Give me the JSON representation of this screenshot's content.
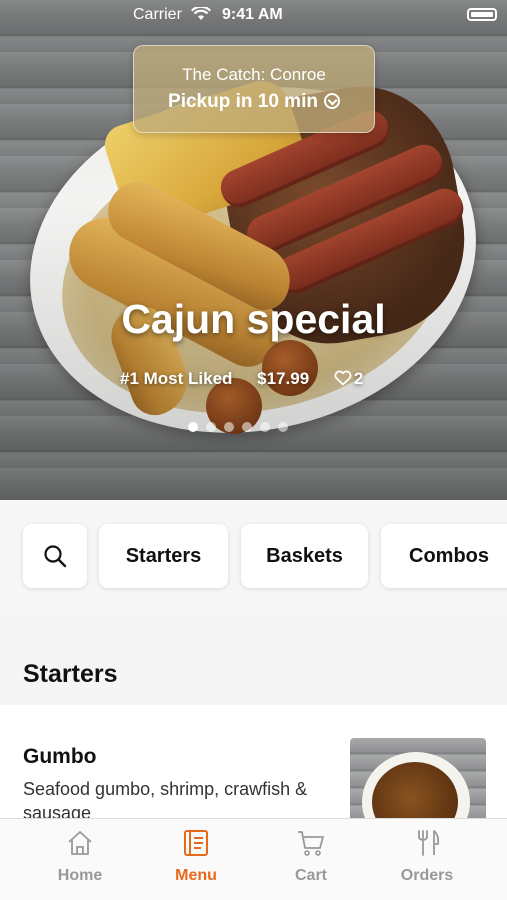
{
  "status_bar": {
    "carrier": "Carrier",
    "time": "9:41 AM"
  },
  "pickup": {
    "location": "The Catch: Conroe",
    "eta": "Pickup in 10 min"
  },
  "hero": {
    "title": "Cajun special",
    "badge": "#1 Most Liked",
    "price": "$17.99",
    "likes": "2",
    "slide_count": 6,
    "active_slide": 1
  },
  "categories": {
    "search_icon": "search-icon",
    "items": [
      "Starters",
      "Baskets",
      "Combos"
    ]
  },
  "section": {
    "title": "Starters"
  },
  "menu_item": {
    "name": "Gumbo",
    "description": "Seafood gumbo, shrimp, crawfish & sausage"
  },
  "tabs": [
    {
      "label": "Home",
      "icon": "home-icon",
      "active": false
    },
    {
      "label": "Menu",
      "icon": "menu-icon",
      "active": true
    },
    {
      "label": "Cart",
      "icon": "cart-icon",
      "active": false
    },
    {
      "label": "Orders",
      "icon": "fork-knife-icon",
      "active": false
    }
  ],
  "colors": {
    "accent": "#e8681a",
    "inactive": "#999999"
  }
}
